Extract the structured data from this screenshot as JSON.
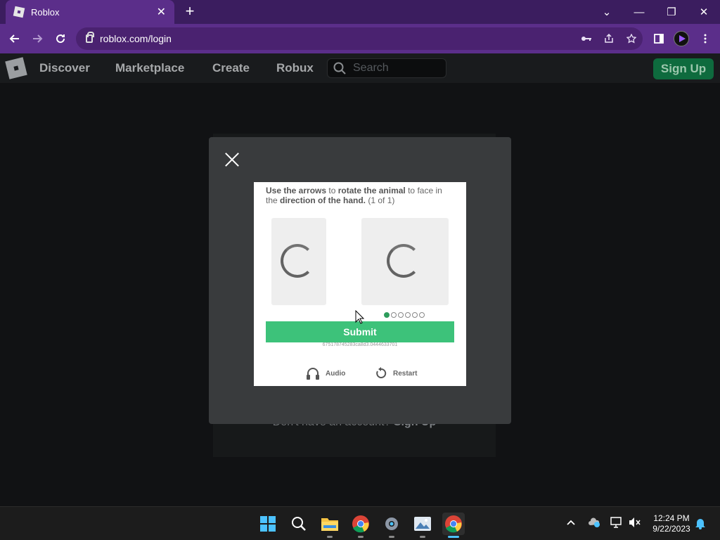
{
  "browser": {
    "tab_title": "Roblox",
    "tab_close": "✕",
    "new_tab": "+",
    "url": "roblox.com/login",
    "window_controls": {
      "minimize": "—",
      "restore": "❐",
      "close": "✕",
      "tab_search": "⌄"
    }
  },
  "roblox_header": {
    "nav": [
      "Discover",
      "Marketplace",
      "Create",
      "Robux"
    ],
    "search_placeholder": "Search",
    "signup_label": "Sign Up"
  },
  "login_background": {
    "no_account_text": "Don't have an account?",
    "signup_link": "Sign Up"
  },
  "captcha": {
    "instruction_part1": "Use the arrows",
    "instruction_part2": " to ",
    "instruction_part3": "rotate the animal",
    "instruction_part4": " to face in the ",
    "instruction_part5": "direction of the hand.",
    "instruction_part6": " (1 of 1)",
    "submit_label": "Submit",
    "session_id": "675178745283ca8d3.0444633701",
    "audio_label": "Audio",
    "restart_label": "Restart",
    "progress": {
      "current": 1,
      "total": 6
    }
  },
  "taskbar": {
    "clock_time": "12:24 PM",
    "clock_date": "9/22/2023",
    "icons": [
      "windows-start-icon",
      "search-icon",
      "file-explorer-icon",
      "chrome-profile-icon",
      "settings-icon",
      "photos-icon",
      "chrome-active-icon"
    ]
  },
  "colors": {
    "browser_frame": "#5b2e8a",
    "tabbar": "#3b1d5f",
    "roblox_bg": "#111214",
    "modal": "#393b3d",
    "submit_green": "#3dc27a",
    "signup_green": "#0e6b3e"
  }
}
